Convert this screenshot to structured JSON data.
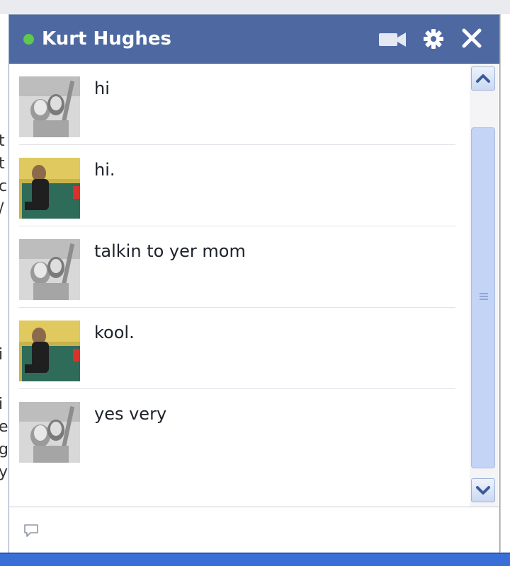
{
  "chat": {
    "contact_name": "Kurt Hughes",
    "status": "online",
    "status_color": "#5fc84e",
    "header_color": "#4e69a2",
    "header_icons": [
      "video-call-icon",
      "gear-icon",
      "close-icon"
    ],
    "messages": [
      {
        "sender_avatar": "friend-photo",
        "text": "hi"
      },
      {
        "sender_avatar": "self-photo",
        "text": "hi."
      },
      {
        "sender_avatar": "friend-photo",
        "text": "talkin to yer mom"
      },
      {
        "sender_avatar": "self-photo",
        "text": "kool."
      },
      {
        "sender_avatar": "friend-photo",
        "text": "yes very"
      }
    ],
    "input": {
      "value": "",
      "placeholder": ""
    }
  }
}
